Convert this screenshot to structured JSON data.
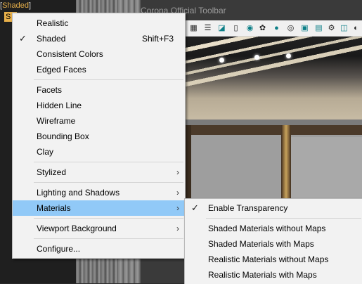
{
  "viewport": {
    "label_open": "[",
    "label_text": "Shaded",
    "label_close": "]",
    "chip_text": "S"
  },
  "toolbar": {
    "title": "Corona Official Toolbar",
    "icons": [
      "grid-icon",
      "list-icon",
      "corona-logo-icon",
      "document-icon",
      "render-icon",
      "gear-icon",
      "sphere-icon",
      "light-icon",
      "frame-icon",
      "camera-icon",
      "link-icon",
      "settings-icon",
      "crop-icon",
      "eye-icon"
    ]
  },
  "main_menu": {
    "items": [
      {
        "label": "Realistic"
      },
      {
        "label": "Shaded",
        "checked": true,
        "shortcut": "Shift+F3"
      },
      {
        "label": "Consistent Colors"
      },
      {
        "label": "Edged Faces"
      },
      {
        "label": "Facets"
      },
      {
        "label": "Hidden Line"
      },
      {
        "label": "Wireframe"
      },
      {
        "label": "Bounding Box"
      },
      {
        "label": "Clay"
      },
      {
        "label": "Stylized",
        "submenu": true
      },
      {
        "label": "Lighting and Shadows",
        "submenu": true
      },
      {
        "label": "Materials",
        "submenu": true,
        "highlighted": true
      },
      {
        "label": "Viewport Background",
        "submenu": true
      },
      {
        "label": "Configure..."
      }
    ],
    "checkmark": "✓",
    "chevron": "›"
  },
  "materials_submenu": {
    "items": [
      {
        "label": "Enable Transparency",
        "checked": true
      },
      {
        "label": "Shaded Materials without Maps"
      },
      {
        "label": "Shaded Materials with Maps"
      },
      {
        "label": "Realistic Materials without Maps"
      },
      {
        "label": "Realistic Materials with Maps"
      }
    ]
  },
  "colors": {
    "highlight": "#91c9f7",
    "menu_bg": "#f2f2f2",
    "viewport_label": "#e8b04a"
  }
}
